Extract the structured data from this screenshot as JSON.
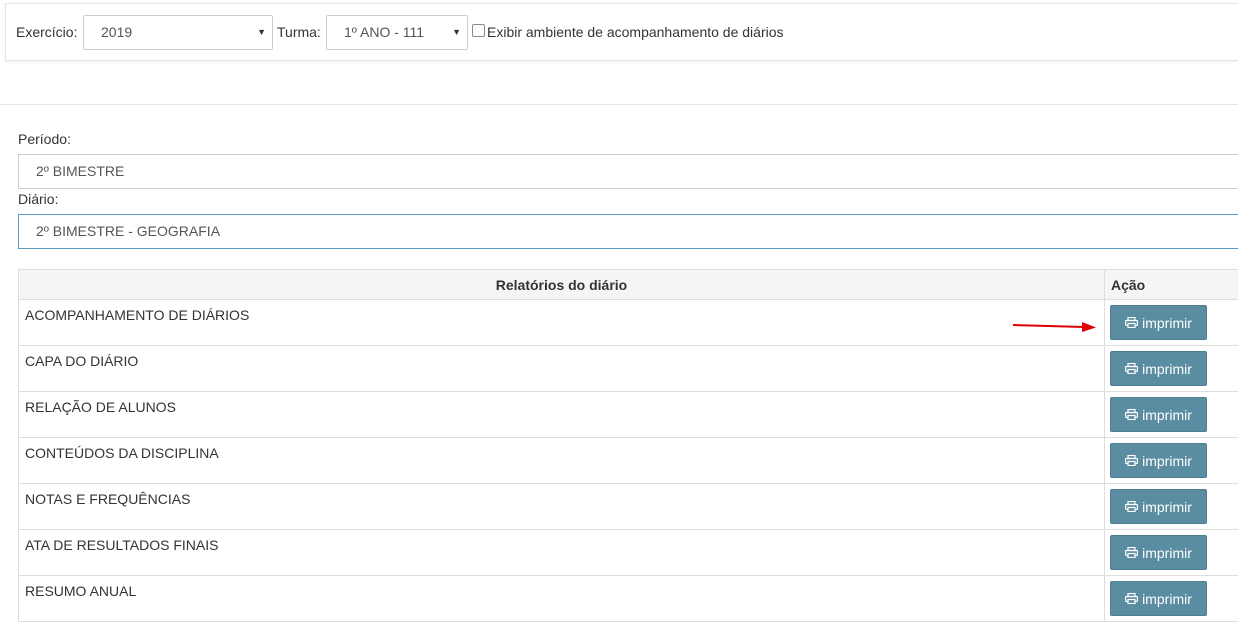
{
  "filters": {
    "exercicio_label": "Exercício:",
    "exercicio_value": "2019",
    "turma_label": "Turma:",
    "turma_value": "1º ANO - 111",
    "exibir_label": "Exibir ambiente de acompanhamento de diários"
  },
  "periodo": {
    "label": "Período:",
    "value": "2º BIMESTRE"
  },
  "diario": {
    "label": "Diário:",
    "value": "2º BIMESTRE - GEOGRAFIA"
  },
  "table": {
    "header_report": "Relatórios do diário",
    "header_action": "Ação",
    "button_label": "imprimir",
    "rows": [
      {
        "name": "ACOMPANHAMENTO DE DIÁRIOS"
      },
      {
        "name": "CAPA DO DIÁRIO"
      },
      {
        "name": "RELAÇÃO DE ALUNOS"
      },
      {
        "name": "CONTEÚDOS DA DISCIPLINA"
      },
      {
        "name": "NOTAS E FREQUÊNCIAS"
      },
      {
        "name": "ATA DE RESULTADOS FINAIS"
      },
      {
        "name": "RESUMO ANUAL"
      }
    ]
  },
  "colors": {
    "button_bg": "#5a8da1",
    "annotation_arrow": "#e00000"
  },
  "icons": {
    "button_icon": "printer-icon",
    "select_caret": "caret-down-icon"
  }
}
